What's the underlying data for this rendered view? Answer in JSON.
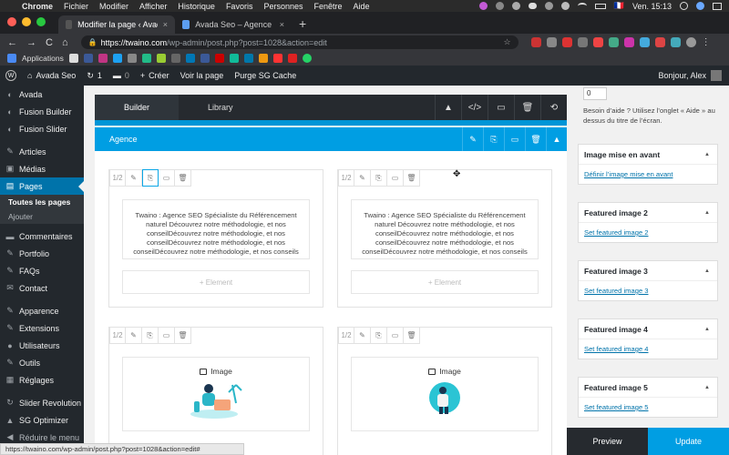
{
  "macbar": {
    "apple": "",
    "menu": [
      "Chrome",
      "Fichier",
      "Modifier",
      "Afficher",
      "Historique",
      "Favoris",
      "Personnes",
      "Fenêtre",
      "Aide"
    ],
    "flag": "🇫🇷",
    "clock": "Ven. 15:13"
  },
  "tabs": [
    {
      "title": "Modifier la page ‹ Avada Seo »",
      "close": "×"
    },
    {
      "title": "Avada Seo – Agence SEO",
      "close": "×"
    }
  ],
  "newtab": "+",
  "toolbar": {
    "back": "←",
    "forward": "→",
    "reload": "C",
    "home": "⌂",
    "lock": "🔒",
    "url_host": "https://twaino.com",
    "url_path": "/wp-admin/post.php?post=1028&action=edit",
    "star": "☆"
  },
  "bookmarks": {
    "apps": "Applications"
  },
  "adminbar": {
    "wp_logo": "W",
    "site": "Avada Seo",
    "updates": "1",
    "comments": "0",
    "create": "Créer",
    "view": "Voir la page",
    "purge": "Purge SG Cache",
    "greeting": "Bonjour, Alex"
  },
  "sidebar": {
    "items_top": [
      {
        "icon": "◐",
        "label": "Avada"
      },
      {
        "icon": "◐",
        "label": "Fusion Builder"
      },
      {
        "icon": "◐",
        "label": "Fusion Slider"
      }
    ],
    "items_mid": [
      {
        "icon": "✎",
        "label": "Articles"
      },
      {
        "icon": "▣",
        "label": "Médias"
      }
    ],
    "active": {
      "icon": "▤",
      "label": "Pages"
    },
    "sub": [
      "Toutes les pages",
      "Ajouter"
    ],
    "items_after": [
      {
        "icon": "▬",
        "label": "Commentaires"
      },
      {
        "icon": "✎",
        "label": "Portfolio"
      },
      {
        "icon": "✎",
        "label": "FAQs"
      },
      {
        "icon": "✉",
        "label": "Contact"
      }
    ],
    "items_bottom": [
      {
        "icon": "✎",
        "label": "Apparence"
      },
      {
        "icon": "✎",
        "label": "Extensions"
      },
      {
        "icon": "●",
        "label": "Utilisateurs"
      },
      {
        "icon": "✎",
        "label": "Outils"
      },
      {
        "icon": "▦",
        "label": "Réglages"
      }
    ],
    "items_end": [
      {
        "icon": "↻",
        "label": "Slider Revolution"
      },
      {
        "icon": "▲",
        "label": "SG Optimizer"
      },
      {
        "icon": "◀",
        "label": "Réduire le menu"
      }
    ]
  },
  "builder": {
    "tab_builder": "Builder",
    "tab_library": "Library",
    "tools": [
      "▲",
      "</>",
      "▭",
      "🗑",
      "⟲"
    ],
    "container_label": "Agence",
    "container_tools": [
      "✎",
      "⎘",
      "▭",
      "🗑",
      "▲"
    ],
    "col_size": "1/2",
    "col_tools": [
      "✎",
      "⎘",
      "▭",
      "🗑"
    ],
    "text_content": "Twaino : Agence SEO Spécialiste du Référencement naturel Découvrez notre méthodologie, et nos conseilDécouvrez notre méthodologie, et nos conseilDécouvrez notre méthodologie, et nos conseilDécouvrez notre méthodologie, et nos conseils",
    "add_element": "+ Element",
    "image_label": "Image"
  },
  "right": {
    "order_value": "0",
    "help_text": "Besoin d’aide ? Utilisez l’onglet « Aide » au dessus du titre de l’écran.",
    "boxes": [
      {
        "title": "Image mise en avant",
        "link": "Définir l’image mise en avant"
      },
      {
        "title": "Featured image 2",
        "link": "Set featured image 2"
      },
      {
        "title": "Featured image 3",
        "link": "Set featured image 3"
      },
      {
        "title": "Featured image 4",
        "link": "Set featured image 4"
      },
      {
        "title": "Featured image 5",
        "link": "Set featured image 5"
      }
    ],
    "collapse_arrow": "▲"
  },
  "bottom": {
    "preview": "Preview",
    "update": "Update"
  },
  "status_url": "https://twaino.com/wp-admin/post.php?post=1028&action=edit#",
  "cursor": "✥"
}
